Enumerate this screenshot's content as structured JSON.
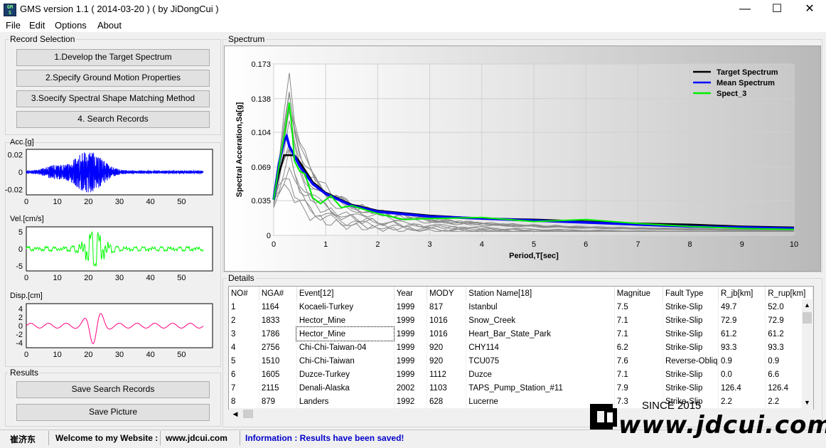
{
  "window": {
    "title": "GMS version 1.1   ( 2014-03-20 ) ( by JiDongCui )",
    "minimize": "—",
    "maximize": "☐",
    "close": "✕"
  },
  "menu": [
    "File",
    "Edit",
    "Options",
    "About"
  ],
  "record_selection": {
    "label": "Record Selection",
    "buttons": [
      "1.Develop the Target Spectrum",
      "2.Specify Ground Motion  Properties",
      "3.Soecify Spectral Shape Matching Method",
      "4. Search Records"
    ]
  },
  "time_plots": [
    {
      "label": "Acc.[g]",
      "yticks": [
        "0.02",
        "0",
        "-0.02"
      ],
      "color": "#0000ff"
    },
    {
      "label": "Vel.[cm/s]",
      "yticks": [
        "5",
        "0",
        "-5"
      ],
      "color": "#00ff00"
    },
    {
      "label": "Disp.[cm]",
      "yticks": [
        "4",
        "2",
        "0",
        "-2",
        "-4"
      ],
      "color": "#ff0080"
    }
  ],
  "time_xticks": [
    "0",
    "10",
    "20",
    "30",
    "40",
    "50"
  ],
  "results": {
    "label": "Results",
    "buttons": [
      "Save Search Records",
      "Save Picture"
    ]
  },
  "spectrum": {
    "label": "Spectrum"
  },
  "chart_data": {
    "type": "line",
    "xlabel": "Period,T[sec]",
    "ylabel": "Spectral Acceration,Sa[g]",
    "xlim": [
      0,
      10
    ],
    "ylim": [
      0,
      0.173
    ],
    "xticks": [
      "0",
      "1",
      "2",
      "3",
      "4",
      "5",
      "6",
      "7",
      "8",
      "9",
      "10"
    ],
    "yticks": [
      "0",
      "0.035",
      "0.069",
      "0.104",
      "0.138",
      "0.173"
    ],
    "grid": true,
    "legend_position": "top-right",
    "series": [
      {
        "name": "Target Spectrum",
        "color": "#000000",
        "x": [
          0,
          0.1,
          0.2,
          0.3,
          0.4,
          0.5,
          0.75,
          1.0,
          1.5,
          2.0,
          3.0,
          4.0,
          5.0,
          6.0,
          7.0,
          8.0,
          9.0,
          10.0
        ],
        "y": [
          0.036,
          0.062,
          0.081,
          0.081,
          0.081,
          0.074,
          0.054,
          0.043,
          0.031,
          0.025,
          0.02,
          0.017,
          0.016,
          0.014,
          0.012,
          0.011,
          0.009,
          0.008
        ]
      },
      {
        "name": "Mean Spectrum",
        "color": "#0000ff",
        "x": [
          0,
          0.1,
          0.2,
          0.25,
          0.3,
          0.4,
          0.5,
          0.75,
          1.0,
          1.5,
          2.0,
          3.0,
          4.0,
          5.0,
          6.0,
          7.0,
          8.0,
          9.0,
          10.0
        ],
        "y": [
          0.036,
          0.072,
          0.095,
          0.1,
          0.09,
          0.08,
          0.07,
          0.052,
          0.042,
          0.03,
          0.024,
          0.019,
          0.017,
          0.015,
          0.013,
          0.011,
          0.009,
          0.008,
          0.007
        ]
      },
      {
        "name": "Spect_3",
        "color": "#00ee00",
        "x": [
          0,
          0.1,
          0.2,
          0.3,
          0.35,
          0.4,
          0.5,
          0.6,
          0.75,
          0.9,
          1.1,
          1.3,
          1.5,
          2.0,
          2.5,
          3.0,
          4.0,
          5.0,
          6.0,
          7.0,
          8.0,
          9.0,
          10.0
        ],
        "y": [
          0.036,
          0.07,
          0.1,
          0.134,
          0.11,
          0.075,
          0.065,
          0.062,
          0.038,
          0.032,
          0.04,
          0.028,
          0.03,
          0.022,
          0.016,
          0.017,
          0.018,
          0.014,
          0.016,
          0.012,
          0.009,
          0.007,
          0.006
        ]
      }
    ]
  },
  "details": {
    "label": "Details",
    "columns": [
      "NO#",
      "NGA#",
      "Event[12]",
      "Year",
      "MODY",
      "Station Name[18]",
      "Magnitue",
      "Fault Type",
      "R_jb[km]",
      "R_rup[km]"
    ],
    "rows": [
      [
        "1",
        "1164",
        "Kocaeli-Turkey",
        "1999",
        "817",
        "Istanbul",
        "7.5",
        "Strike-Slip",
        "49.7",
        "52.0"
      ],
      [
        "2",
        "1833",
        "Hector_Mine",
        "1999",
        "1016",
        "Snow_Creek",
        "7.1",
        "Strike-Slip",
        "72.9",
        "72.9"
      ],
      [
        "3",
        "1786",
        "Hector_Mine",
        "1999",
        "1016",
        "Heart_Bar_State_Park",
        "7.1",
        "Strike-Slip",
        "61.2",
        "61.2"
      ],
      [
        "4",
        "2756",
        "Chi-Chi-Taiwan-04",
        "1999",
        "920",
        "CHY114",
        "6.2",
        "Strike-Slip",
        "93.3",
        "93.3"
      ],
      [
        "5",
        "1510",
        "Chi-Chi-Taiwan",
        "1999",
        "920",
        "TCU075",
        "7.6",
        "Reverse-Obliq",
        "0.9",
        "0.9"
      ],
      [
        "6",
        "1605",
        "Duzce-Turkey",
        "1999",
        "1112",
        "Duzce",
        "7.1",
        "Strike-Slip",
        "0.0",
        "6.6"
      ],
      [
        "7",
        "2115",
        "Denali-Alaska",
        "2002",
        "1103",
        "TAPS_Pump_Station_#11",
        "7.9",
        "Strike-Slip",
        "126.4",
        "126.4"
      ],
      [
        "8",
        "879",
        "Landers",
        "1992",
        "628",
        "Lucerne",
        "7.3",
        "Strike-Slip",
        "2.2",
        "2.2"
      ]
    ]
  },
  "status": {
    "user": "崔济东",
    "welcome": "Welcome to my Website :",
    "website": "www.jdcui.com",
    "info": "Information : Results have been saved!"
  },
  "watermark": {
    "since": "SINCE 2015",
    "url": "www.jdcui.com"
  }
}
